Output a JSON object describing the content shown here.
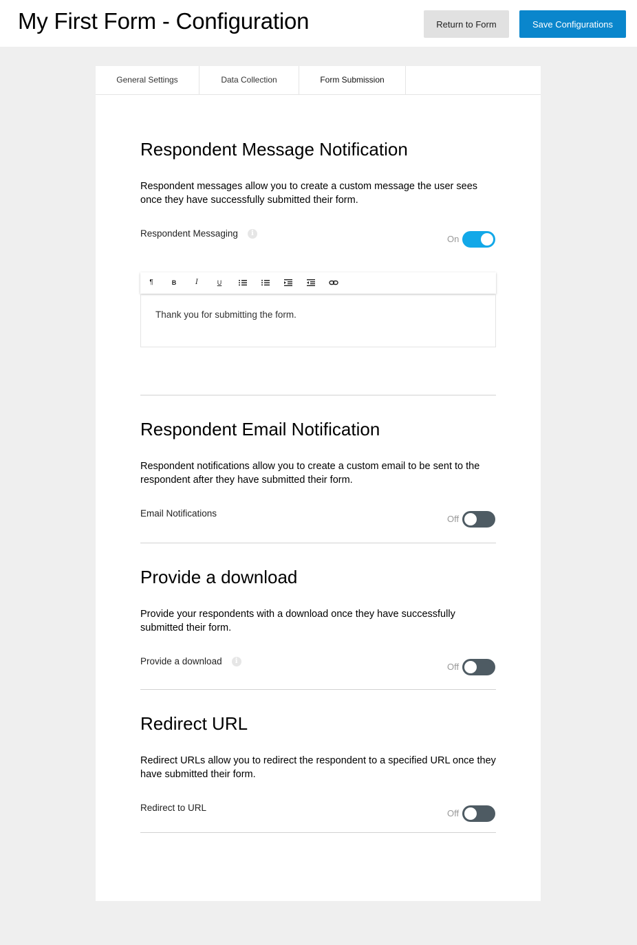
{
  "header": {
    "title": "My First Form - Configuration",
    "return_label": "Return to Form",
    "save_label": "Save Configurations"
  },
  "tabs": [
    {
      "label": "General Settings"
    },
    {
      "label": "Data Collection"
    },
    {
      "label": "Form Submission",
      "active": true
    }
  ],
  "sections": {
    "respondent_message": {
      "title": "Respondent Message Notification",
      "description": "Respondent messages allow you to create a custom message the user sees once they have successfully submitted their form.",
      "setting_label": "Respondent Messaging",
      "toggle_state": "On",
      "editor": {
        "toolbar": [
          "paragraph-icon",
          "bold-icon",
          "italic-icon",
          "underline-icon",
          "ordered-list-icon",
          "unordered-list-icon",
          "indent-icon",
          "outdent-icon",
          "link-icon"
        ],
        "content": "Thank you for submitting the form."
      }
    },
    "respondent_email": {
      "title": "Respondent Email Notification",
      "description": "Respondent notifications allow you to create a custom email to be sent to the respondent after they have submitted their form.",
      "setting_label": "Email Notifications",
      "toggle_state": "Off"
    },
    "download": {
      "title": "Provide a download",
      "description": "Provide your respondents with a download once they have successfully submitted their form.",
      "setting_label": "Provide a download",
      "toggle_state": "Off"
    },
    "redirect": {
      "title": "Redirect URL",
      "description": "Redirect URLs allow you to redirect the respondent to a specified URL once they have submitted their form.",
      "setting_label": "Redirect to URL",
      "toggle_state": "Off"
    }
  },
  "colors": {
    "accent": "#0a86cc",
    "toggle_on": "#12a8e8",
    "toggle_off": "#4e5b63",
    "background": "#efefef"
  }
}
